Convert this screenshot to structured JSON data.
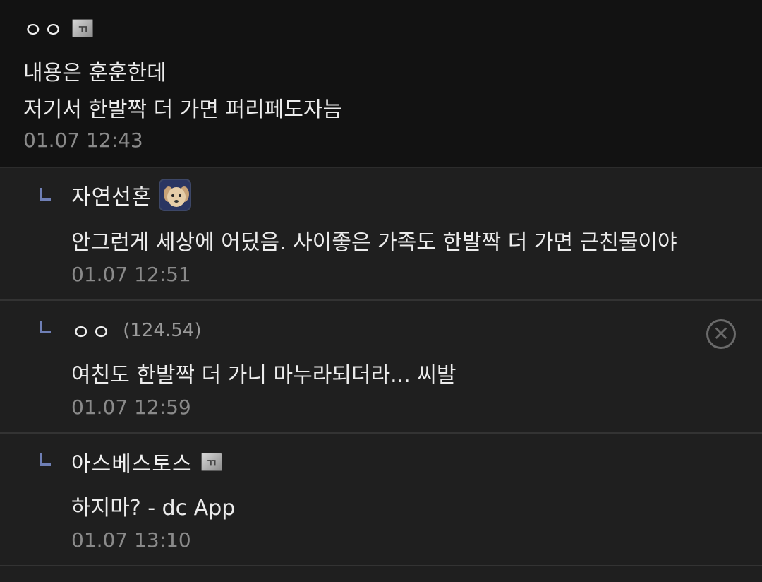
{
  "main_comment": {
    "nickname": "ㅇㅇ",
    "body_line1": "내용은 훈훈한데",
    "body_line2": "저기서 한발짝 더 가면 퍼리페도자늠",
    "timestamp": "01.07 12:43"
  },
  "replies": [
    {
      "nickname": "자연선혼",
      "body": "안그런게 세상에 어딨음. 사이좋은 가족도 한발짝 더 가면 근친물이야",
      "timestamp": "01.07 12:51"
    },
    {
      "nickname": "ㅇㅇ",
      "ip": "(124.54)",
      "body": "여친도 한발짝 더 가니 마누라되더라... 씨발",
      "timestamp": "01.07 12:59"
    },
    {
      "nickname": "아스베스토스",
      "body": "하지마? - dc App",
      "timestamp": "01.07 13:10"
    }
  ],
  "icons": {
    "reply_arrow": "reply-arrow-icon",
    "delete": "delete-circle-icon",
    "gallery_badge": "fixed-nick-badge-icon"
  },
  "colors": {
    "background": "#1f1f1f",
    "main_background": "#121212",
    "reply_arrow": "#6f7fb5",
    "timestamp": "#8a8a8a"
  }
}
